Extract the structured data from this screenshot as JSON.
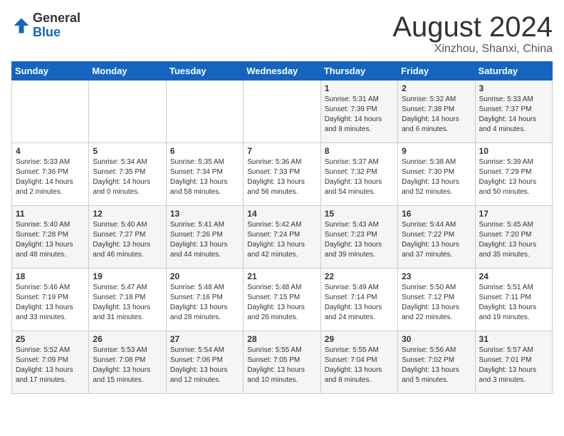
{
  "header": {
    "logo_general": "General",
    "logo_blue": "Blue",
    "month": "August 2024",
    "location": "Xinzhou, Shanxi, China"
  },
  "weekdays": [
    "Sunday",
    "Monday",
    "Tuesday",
    "Wednesday",
    "Thursday",
    "Friday",
    "Saturday"
  ],
  "weeks": [
    [
      {
        "day": "",
        "info": ""
      },
      {
        "day": "",
        "info": ""
      },
      {
        "day": "",
        "info": ""
      },
      {
        "day": "",
        "info": ""
      },
      {
        "day": "1",
        "info": "Sunrise: 5:31 AM\nSunset: 7:39 PM\nDaylight: 14 hours\nand 8 minutes."
      },
      {
        "day": "2",
        "info": "Sunrise: 5:32 AM\nSunset: 7:38 PM\nDaylight: 14 hours\nand 6 minutes."
      },
      {
        "day": "3",
        "info": "Sunrise: 5:33 AM\nSunset: 7:37 PM\nDaylight: 14 hours\nand 4 minutes."
      }
    ],
    [
      {
        "day": "4",
        "info": "Sunrise: 5:33 AM\nSunset: 7:36 PM\nDaylight: 14 hours\nand 2 minutes."
      },
      {
        "day": "5",
        "info": "Sunrise: 5:34 AM\nSunset: 7:35 PM\nDaylight: 14 hours\nand 0 minutes."
      },
      {
        "day": "6",
        "info": "Sunrise: 5:35 AM\nSunset: 7:34 PM\nDaylight: 13 hours\nand 58 minutes."
      },
      {
        "day": "7",
        "info": "Sunrise: 5:36 AM\nSunset: 7:33 PM\nDaylight: 13 hours\nand 56 minutes."
      },
      {
        "day": "8",
        "info": "Sunrise: 5:37 AM\nSunset: 7:32 PM\nDaylight: 13 hours\nand 54 minutes."
      },
      {
        "day": "9",
        "info": "Sunrise: 5:38 AM\nSunset: 7:30 PM\nDaylight: 13 hours\nand 52 minutes."
      },
      {
        "day": "10",
        "info": "Sunrise: 5:39 AM\nSunset: 7:29 PM\nDaylight: 13 hours\nand 50 minutes."
      }
    ],
    [
      {
        "day": "11",
        "info": "Sunrise: 5:40 AM\nSunset: 7:28 PM\nDaylight: 13 hours\nand 48 minutes."
      },
      {
        "day": "12",
        "info": "Sunrise: 5:40 AM\nSunset: 7:27 PM\nDaylight: 13 hours\nand 46 minutes."
      },
      {
        "day": "13",
        "info": "Sunrise: 5:41 AM\nSunset: 7:26 PM\nDaylight: 13 hours\nand 44 minutes."
      },
      {
        "day": "14",
        "info": "Sunrise: 5:42 AM\nSunset: 7:24 PM\nDaylight: 13 hours\nand 42 minutes."
      },
      {
        "day": "15",
        "info": "Sunrise: 5:43 AM\nSunset: 7:23 PM\nDaylight: 13 hours\nand 39 minutes."
      },
      {
        "day": "16",
        "info": "Sunrise: 5:44 AM\nSunset: 7:22 PM\nDaylight: 13 hours\nand 37 minutes."
      },
      {
        "day": "17",
        "info": "Sunrise: 5:45 AM\nSunset: 7:20 PM\nDaylight: 13 hours\nand 35 minutes."
      }
    ],
    [
      {
        "day": "18",
        "info": "Sunrise: 5:46 AM\nSunset: 7:19 PM\nDaylight: 13 hours\nand 33 minutes."
      },
      {
        "day": "19",
        "info": "Sunrise: 5:47 AM\nSunset: 7:18 PM\nDaylight: 13 hours\nand 31 minutes."
      },
      {
        "day": "20",
        "info": "Sunrise: 5:48 AM\nSunset: 7:16 PM\nDaylight: 13 hours\nand 28 minutes."
      },
      {
        "day": "21",
        "info": "Sunrise: 5:48 AM\nSunset: 7:15 PM\nDaylight: 13 hours\nand 26 minutes."
      },
      {
        "day": "22",
        "info": "Sunrise: 5:49 AM\nSunset: 7:14 PM\nDaylight: 13 hours\nand 24 minutes."
      },
      {
        "day": "23",
        "info": "Sunrise: 5:50 AM\nSunset: 7:12 PM\nDaylight: 13 hours\nand 22 minutes."
      },
      {
        "day": "24",
        "info": "Sunrise: 5:51 AM\nSunset: 7:11 PM\nDaylight: 13 hours\nand 19 minutes."
      }
    ],
    [
      {
        "day": "25",
        "info": "Sunrise: 5:52 AM\nSunset: 7:09 PM\nDaylight: 13 hours\nand 17 minutes."
      },
      {
        "day": "26",
        "info": "Sunrise: 5:53 AM\nSunset: 7:08 PM\nDaylight: 13 hours\nand 15 minutes."
      },
      {
        "day": "27",
        "info": "Sunrise: 5:54 AM\nSunset: 7:06 PM\nDaylight: 13 hours\nand 12 minutes."
      },
      {
        "day": "28",
        "info": "Sunrise: 5:55 AM\nSunset: 7:05 PM\nDaylight: 13 hours\nand 10 minutes."
      },
      {
        "day": "29",
        "info": "Sunrise: 5:55 AM\nSunset: 7:04 PM\nDaylight: 13 hours\nand 8 minutes."
      },
      {
        "day": "30",
        "info": "Sunrise: 5:56 AM\nSunset: 7:02 PM\nDaylight: 13 hours\nand 5 minutes."
      },
      {
        "day": "31",
        "info": "Sunrise: 5:57 AM\nSunset: 7:01 PM\nDaylight: 13 hours\nand 3 minutes."
      }
    ]
  ]
}
